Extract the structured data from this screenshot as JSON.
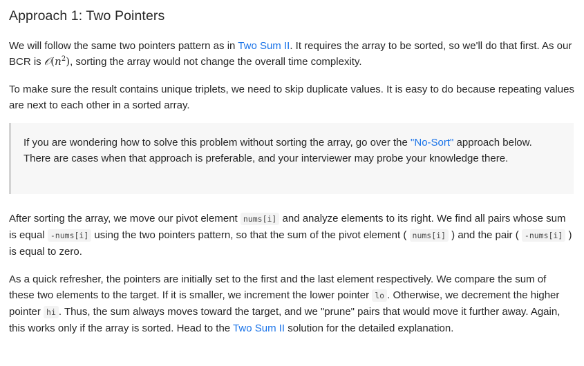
{
  "heading": "Approach 1: Two Pointers",
  "para1": {
    "t1": "We will follow the same two pointers pattern as in ",
    "link1": "Two Sum II",
    "t2": ". It requires the array to be sorted, so we'll do that first. As our BCR is ",
    "math_O": "𝒪",
    "math_open": "(",
    "math_n": "n",
    "math_exp": "2",
    "math_close": ")",
    "t3": ", sorting the array would not change the overall time complexity."
  },
  "para2": {
    "text": "To make sure the result contains unique triplets, we need to skip duplicate values. It is easy to do because repeating values are next to each other in a sorted array."
  },
  "callout": {
    "t1": "If you are wondering how to solve this problem without sorting the array, go over the ",
    "link": "\"No-Sort\"",
    "t2": " approach below. There are cases when that approach is preferable, and your interviewer may probe your knowledge there."
  },
  "para3": {
    "t1": "After sorting the array, we move our pivot element ",
    "c1": "nums[i]",
    "t2": " and analyze elements to its right. We find all pairs whose sum is equal ",
    "c2": "-nums[i]",
    "t3": " using the two pointers pattern, so that the sum of the pivot element ( ",
    "c3": "nums[i]",
    "t4": " ) and the pair ( ",
    "c4": "-nums[i]",
    "t5": " ) is equal to zero."
  },
  "para4": {
    "t1": "As a quick refresher, the pointers are initially set to the first and the last element respectively. We compare the sum of these two elements to the target. If it is smaller, we increment the lower pointer ",
    "c1": "lo",
    "t2": ". Otherwise, we decrement the higher pointer ",
    "c2": "hi",
    "t3": ". Thus, the sum always moves toward the target, and we \"prune\" pairs that would move it further away. Again, this works only if the array is sorted. Head to the ",
    "link": "Two Sum II",
    "t4": " solution for the detailed explanation."
  },
  "colors": {
    "text": "#262626",
    "link": "#1a73e8",
    "callout_bg": "#f7f7f7",
    "callout_border": "#d3d3d3",
    "code_bg": "#f3f3f3"
  }
}
